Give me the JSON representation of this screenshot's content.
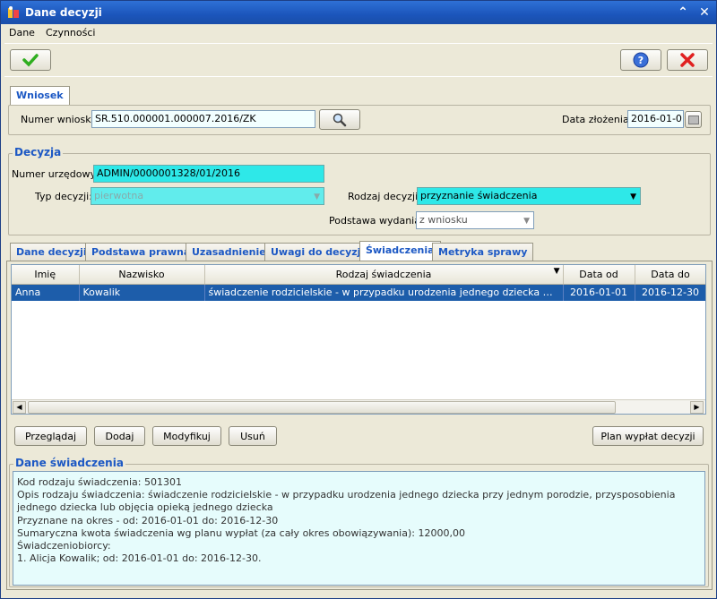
{
  "window": {
    "title": "Dane decyzji"
  },
  "menu": {
    "items": [
      "Dane",
      "Czynności"
    ]
  },
  "toolbar": {
    "accept_icon": "checkmark-icon",
    "help_icon": "help-icon",
    "close_icon": "red-x-icon"
  },
  "wniosek": {
    "tab_label": "Wniosek",
    "numer_label": "Numer wniosku:",
    "numer_value": "SR.510.000001.000007.2016/ZK",
    "data_label": "Data złożenia:",
    "data_value": "2016-01-01"
  },
  "decyzja": {
    "section_title": "Decyzja",
    "numer_label": "Numer urzędowy:",
    "numer_value": "ADMIN/0000001328/01/2016",
    "typ_label": "Typ decyzji:",
    "typ_value": "pierwotna",
    "rodzaj_label": "Rodzaj decyzji:",
    "rodzaj_value": "przyznanie świadczenia",
    "podstawa_label": "Podstawa wydania:",
    "podstawa_value": "z wniosku"
  },
  "tabs": [
    {
      "label": "Dane decyzji"
    },
    {
      "label": "Podstawa prawna"
    },
    {
      "label": "Uzasadnienie"
    },
    {
      "label": "Uwagi do decyzji"
    },
    {
      "label": "Świadczenia"
    },
    {
      "label": "Metryka sprawy"
    }
  ],
  "grid": {
    "columns": [
      "Imię",
      "Nazwisko",
      "Rodzaj świadczenia",
      "Data od",
      "Data do"
    ],
    "rows": [
      [
        "Anna",
        "Kowalik",
        "świadczenie rodzicielskie - w przypadku urodzenia jednego dziecka przy jednym porodzie",
        "2016-01-01",
        "2016-12-30"
      ]
    ]
  },
  "actions": {
    "przegladaj": "Przeglądaj",
    "dodaj": "Dodaj",
    "modyfikuj": "Modyfikuj",
    "usun": "Usuń",
    "plan": "Plan wypłat decyzji"
  },
  "dane_swiadczenia": {
    "title": "Dane świadczenia",
    "lines": [
      "Kod rodzaju świadczenia: 501301",
      "Opis rodzaju świadczenia: świadczenie rodzicielskie - w przypadku urodzenia jednego dziecka przy jednym porodzie, przysposobienia jednego dziecka lub objęcia opieką jednego dziecka",
      "Przyznane na okres - od: 2016-01-01 do: 2016-12-30",
      "Sumaryczna kwota świadczenia wg planu wypłat (za cały okres obowiązywania): 12000,00",
      "Świadczeniobiorcy:",
      "1. Alicja Kowalik; od: 2016-01-01 do: 2016-12-30."
    ]
  }
}
